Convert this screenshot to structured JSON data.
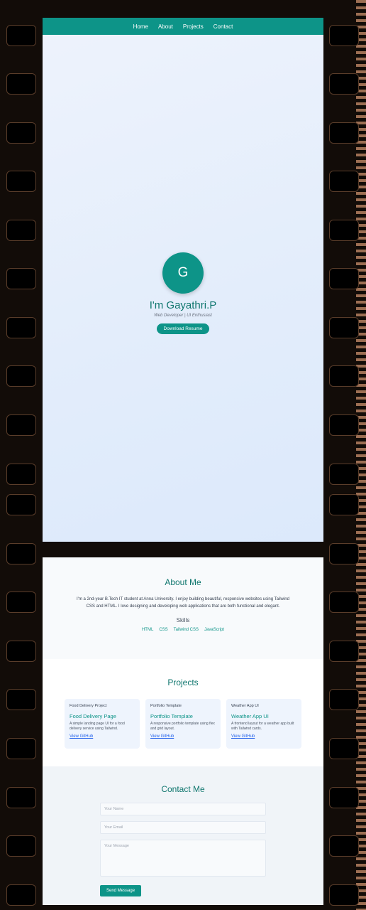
{
  "nav": {
    "items": [
      "Home",
      "About",
      "Projects",
      "Contact"
    ]
  },
  "hero": {
    "avatar_initial": "G",
    "name": "I'm Gayathri.P",
    "tagline": "Web Developer | UI Enthusiast",
    "resume_button": "Download Resume"
  },
  "about": {
    "title": "About Me",
    "text": "I'm a 2nd-year B.Tech IT student at Anna University. I enjoy building beautiful, responsive websites using Tailwind CSS and HTML. I love designing and developing web applications that are both functional and elegant.",
    "skills_title": "Skills",
    "skills": [
      "HTML",
      "CSS",
      "Tailwind CSS",
      "JavaScript"
    ]
  },
  "projects": {
    "title": "Projects",
    "items": [
      {
        "image_alt": "Food Delivery Project",
        "title": "Food Delivery Page",
        "description": "A simple landing page UI for a food delivery service using Tailwind.",
        "link": "View GitHub"
      },
      {
        "image_alt": "Portfolio Template",
        "title": "Portfolio Template",
        "description": "A responsive portfolio template using flex and grid layout.",
        "link": "View GitHub"
      },
      {
        "image_alt": "Weather App UI",
        "title": "Weather App UI",
        "description": "A frontend layout for a weather app built with Tailwind cards.",
        "link": "View GitHub"
      }
    ]
  },
  "contact": {
    "title": "Contact Me",
    "name_placeholder": "Your Name",
    "email_placeholder": "Your Email",
    "message_placeholder": "Your Message",
    "send_button": "Send Message"
  },
  "colors": {
    "accent": "#0d9488",
    "heading": "#0f766e",
    "link": "#2563eb"
  }
}
